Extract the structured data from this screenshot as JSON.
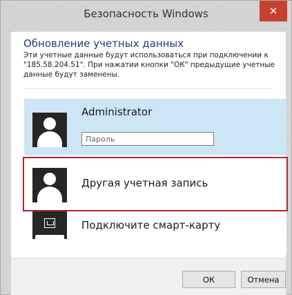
{
  "window": {
    "title": "Безопасность Windows",
    "close_glyph": "✕"
  },
  "dialog": {
    "heading": "Обновление учетных данных",
    "description": "Эти учетные данные будут использоваться при подключении к \"185.58.204.51\". При нажатии кнопки \"ОК\" предыдущие учетные данные будут заменены."
  },
  "accounts": [
    {
      "name": "Administrator",
      "icon": "user-avatar-icon",
      "selected": true
    },
    {
      "name": "Другая учетная запись",
      "icon": "user-avatar-icon",
      "highlighted": true
    },
    {
      "name": "Подключите смарт-карту",
      "icon": "smart-card-icon"
    }
  ],
  "password": {
    "placeholder": "Пароль",
    "value": ""
  },
  "buttons": {
    "ok": "ОК",
    "cancel": "Отмена"
  },
  "colors": {
    "selected_tile": "#cde6f5",
    "highlight_border": "#b22030",
    "heading": "#1f3d7a",
    "close_button": "#c84030"
  }
}
